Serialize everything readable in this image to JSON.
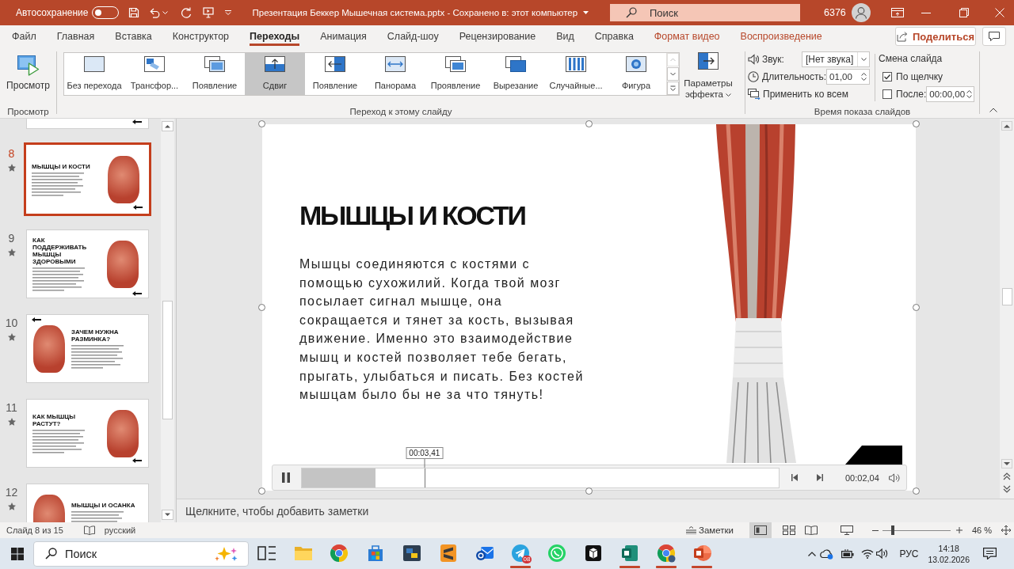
{
  "title_bar": {
    "autosave_label": "Автосохранение",
    "autosave_on": false,
    "document_title": "Презентация Беккер Мышечная система.pptx - Сохранено в: этот компьютер",
    "search_placeholder": "Поиск",
    "user_label": "6376"
  },
  "ribbon_tabs": [
    {
      "label": "Файл",
      "kind": "standard",
      "selected": false
    },
    {
      "label": "Главная",
      "kind": "standard",
      "selected": false
    },
    {
      "label": "Вставка",
      "kind": "standard",
      "selected": false
    },
    {
      "label": "Конструктор",
      "kind": "standard",
      "selected": false
    },
    {
      "label": "Переходы",
      "kind": "standard",
      "selected": true
    },
    {
      "label": "Анимация",
      "kind": "standard",
      "selected": false
    },
    {
      "label": "Слайд-шоу",
      "kind": "standard",
      "selected": false
    },
    {
      "label": "Рецензирование",
      "kind": "standard",
      "selected": false
    },
    {
      "label": "Вид",
      "kind": "standard",
      "selected": false
    },
    {
      "label": "Справка",
      "kind": "standard",
      "selected": false
    },
    {
      "label": "Формат видео",
      "kind": "contextual",
      "selected": false
    },
    {
      "label": "Воспроизведение",
      "kind": "contextual",
      "selected": false
    }
  ],
  "share_button": "Поделиться",
  "ribbon": {
    "preview_group": {
      "button": "Просмотр",
      "label": "Просмотр"
    },
    "transitions_group": {
      "items": [
        {
          "label": "Без перехода",
          "kind": "none",
          "selected": false
        },
        {
          "label": "Трансфор...",
          "kind": "morph",
          "selected": false
        },
        {
          "label": "Появление",
          "kind": "fade",
          "selected": false
        },
        {
          "label": "Сдвиг",
          "kind": "push",
          "selected": true
        },
        {
          "label": "Появление",
          "kind": "wipe",
          "selected": false
        },
        {
          "label": "Панорама",
          "kind": "split",
          "selected": false
        },
        {
          "label": "Проявление",
          "kind": "reveal",
          "selected": false
        },
        {
          "label": "Вырезание",
          "kind": "cut",
          "selected": false
        },
        {
          "label": "Случайные...",
          "kind": "random-bars",
          "selected": false
        },
        {
          "label": "Фигура",
          "kind": "shape",
          "selected": false
        }
      ],
      "effect_options": "Параметры эффекта",
      "label": "Переход к этому слайду"
    },
    "timing_group": {
      "sound": {
        "label": "Звук:",
        "value": "[Нет звука]"
      },
      "duration": {
        "label": "Длительность:",
        "value": "01,00"
      },
      "apply_to_all": "Применить ко всем",
      "advance": {
        "title": "Смена слайда",
        "on_click": {
          "label": "По щелчку",
          "checked": true
        },
        "after": {
          "label": "После:",
          "checked": false,
          "value": "00:00,00"
        }
      },
      "label": "Время показа слайдов"
    }
  },
  "slide_panel": {
    "thumbnails": [
      {
        "kind": "cut-off",
        "selected": false,
        "arrow_bottom": true
      },
      {
        "kind": "image-right",
        "number": "8",
        "title": "МЫШЦЫ И КОСТИ",
        "selected": true,
        "transition": true,
        "arrow_top": false,
        "arrow_bottom": true
      },
      {
        "kind": "image-right",
        "number": "9",
        "title": "КАК ПОДДЕРЖИВАТЬ МЫШЦЫ ЗДОРОВЫМИ",
        "selected": false,
        "transition": true,
        "arrow_top": false,
        "arrow_bottom": true
      },
      {
        "kind": "image-left",
        "number": "10",
        "title": "ЗАЧЕМ НУЖНА РАЗМИНКА?",
        "selected": false,
        "transition": true,
        "arrow_top": true,
        "arrow_bottom": false
      },
      {
        "kind": "image-right",
        "number": "11",
        "title": "КАК МЫШЦЫ РАСТУТ?",
        "selected": false,
        "transition": true,
        "arrow_top": false,
        "arrow_bottom": true
      },
      {
        "kind": "image-left",
        "number": "12",
        "title": "МЫШЦЫ И ОСАНКА",
        "selected": false,
        "transition": true,
        "arrow_top": false
      }
    ]
  },
  "slide": {
    "title": "МЫШЦЫ И КОСТИ",
    "body": "Мышцы соединяются с костями с помощью сухожилий. Когда твой мозг посылает сигнал мышце, она сокращается и тянет за кость, вызывая движение. Именно это взаимодействие мышц и костей позволяет тебе бегать, прыгать, улыбаться и писать. Без костей мышцам было бы не за что тянуть!",
    "video": {
      "selected": true,
      "playing": true,
      "level": 0.154,
      "hover": {
        "time": "00:03,41",
        "level": 0.258
      },
      "time": "00:02,04"
    }
  },
  "notes_placeholder": "Щелкните, чтобы добавить заметки",
  "status_bar": {
    "slide_info": "Слайд 8 из 15",
    "language": "русский",
    "notes_button": "Заметки",
    "views": [
      {
        "kind": "normal",
        "selected": true
      },
      {
        "kind": "sorter",
        "selected": false
      },
      {
        "kind": "reading",
        "selected": false
      },
      {
        "kind": "slideshow",
        "selected": false
      }
    ],
    "zoom": {
      "level": 0.15,
      "value": "46 %"
    }
  },
  "taskbar": {
    "search_placeholder": "Поиск",
    "apps": [
      {
        "kind": "task-view",
        "running": false
      },
      {
        "kind": "folder",
        "running": false
      },
      {
        "kind": "browser",
        "running": false
      },
      {
        "kind": "store",
        "running": false
      },
      {
        "kind": "code",
        "running": false
      },
      {
        "kind": "editor",
        "running": false
      },
      {
        "kind": "mail",
        "running": false
      },
      {
        "kind": "messenger",
        "running": true,
        "badge": "08"
      },
      {
        "kind": "chat",
        "running": false
      },
      {
        "kind": "cube",
        "running": false
      },
      {
        "kind": "publisher",
        "running": true
      },
      {
        "kind": "browser-alt",
        "running": true
      },
      {
        "kind": "presentation",
        "running": true
      }
    ],
    "tray": {
      "language": "РУС",
      "time": "14:18",
      "date": "13.02.2026"
    }
  }
}
